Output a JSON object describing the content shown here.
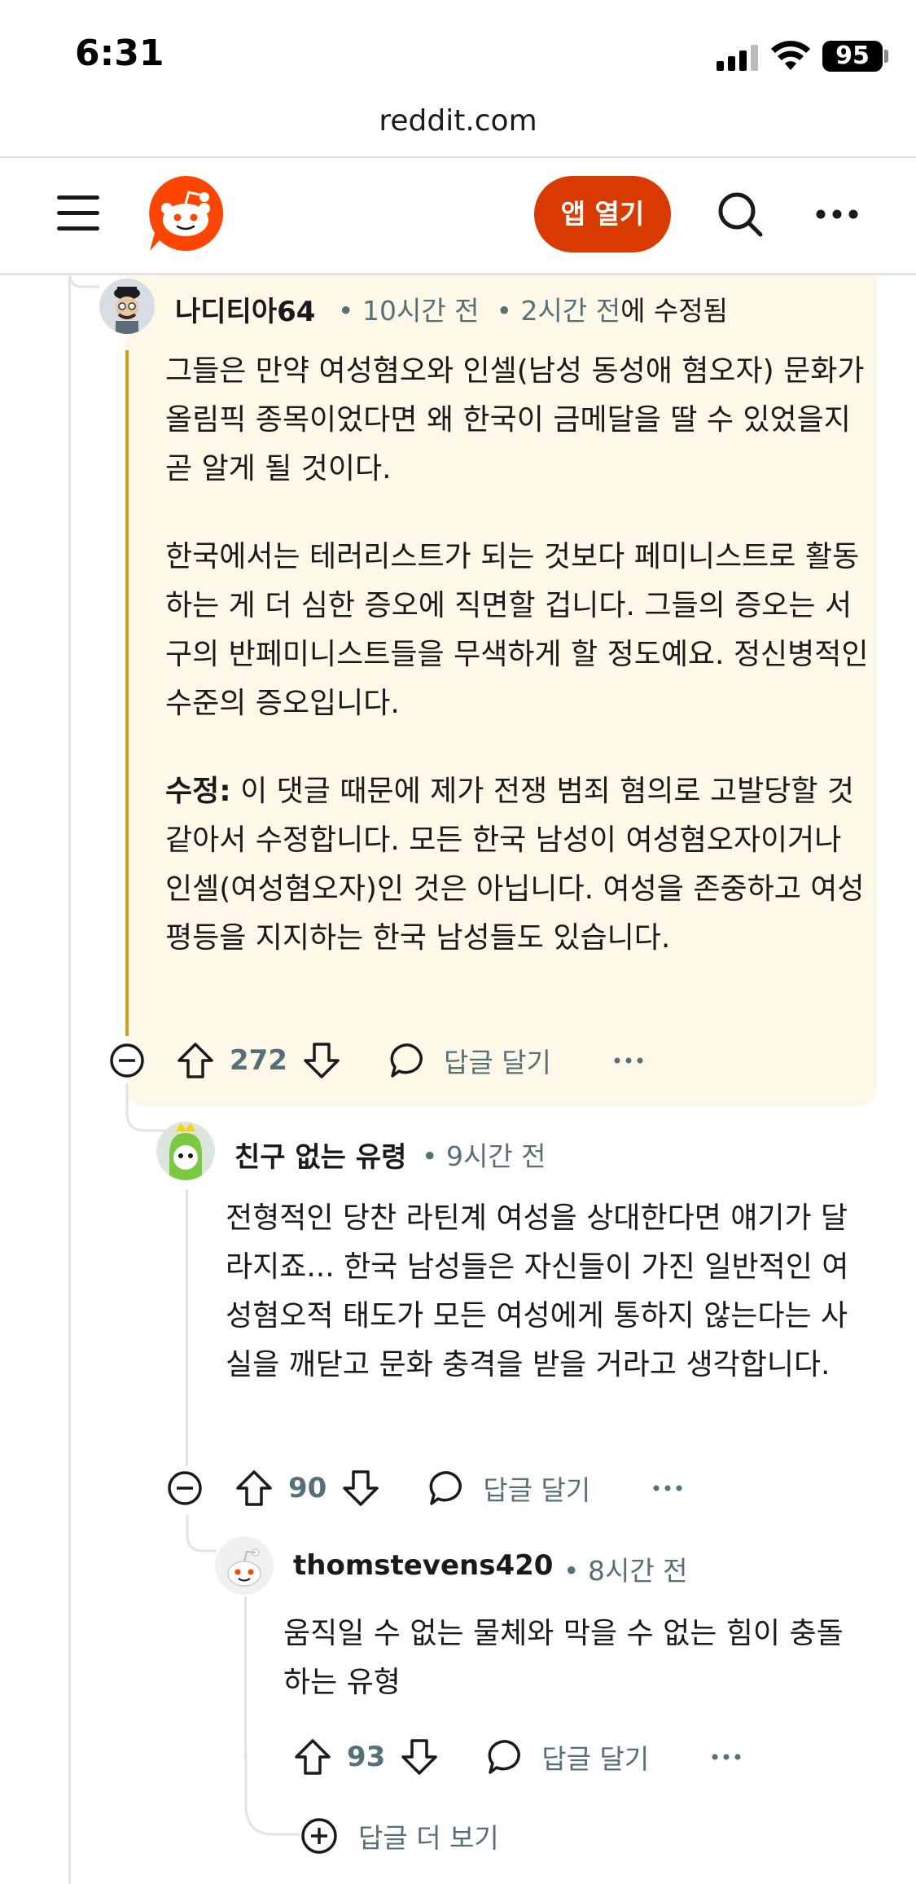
{
  "status_bar": {
    "time": "6:31",
    "battery": "95"
  },
  "browser": {
    "url": "reddit.com"
  },
  "nav": {
    "open_app_label": "앱 열기"
  },
  "comments": [
    {
      "username": "나디티아64",
      "time": "10시간 전",
      "edited": "2시간 전",
      "edited_suffix": "에 수정됨",
      "paragraphs": [
        "그들은 만약 여성혐오와 인셀(남성 동성애 혐오자) 문화가 올림픽 종목이었다면 왜 한국이 금메달을 딸 수 있었을지 곧 알게 될 것이다.",
        "한국에서는 테러리스트가 되는 것보다 페미니스트로 활동하는 게 더 심한 증오에 직면할 겁니다. 그들의 증오는 서구의 반페미니스트들을 무색하게 할 정도예요. 정신병적인 수준의 증오입니다."
      ],
      "edit_label": "수정:",
      "edit_text": " 이 댓글 때문에 제가 전쟁 범죄 혐의로 고발당할 것 같아서 수정합니다. 모든 한국 남성이 여성혐오자이거나 인셀(여성혐오자)인 것은 아닙니다. 여성을 존중하고 여성 평등을 지지하는 한국 남성들도 있습니다.",
      "votes": "272",
      "reply_label": "답글 달기"
    },
    {
      "username": "친구 없는 유령",
      "time": "9시간 전",
      "text": "전형적인 당찬 라틴계 여성을 상대한다면 얘기가 달라지죠... 한국 남성들은 자신들이 가진 일반적인 여성혐오적 태도가 모든 여성에게 통하지 않는다는 사실을 깨닫고 문화 충격을 받을 거라고 생각합니다.",
      "votes": "90",
      "reply_label": "답글 달기"
    },
    {
      "username": "thomstevens420",
      "time": "8시간 전",
      "text": "움직일 수 없는 물체와 막을 수 없는 힘이 충돌하는 유형",
      "votes": "93",
      "reply_label": "답글 달기"
    }
  ],
  "more_replies_label": "답글 더 보기",
  "colors": {
    "accent": "#d93a00",
    "highlight_bg": "#fdf8e8",
    "edited_line": "#c9a227",
    "meta_text": "#576f76"
  },
  "icons": [
    "hamburger-icon",
    "reddit-logo",
    "search-icon",
    "more-icon",
    "collapse-icon",
    "upvote-icon",
    "downvote-icon",
    "reply-icon",
    "expand-icon"
  ]
}
